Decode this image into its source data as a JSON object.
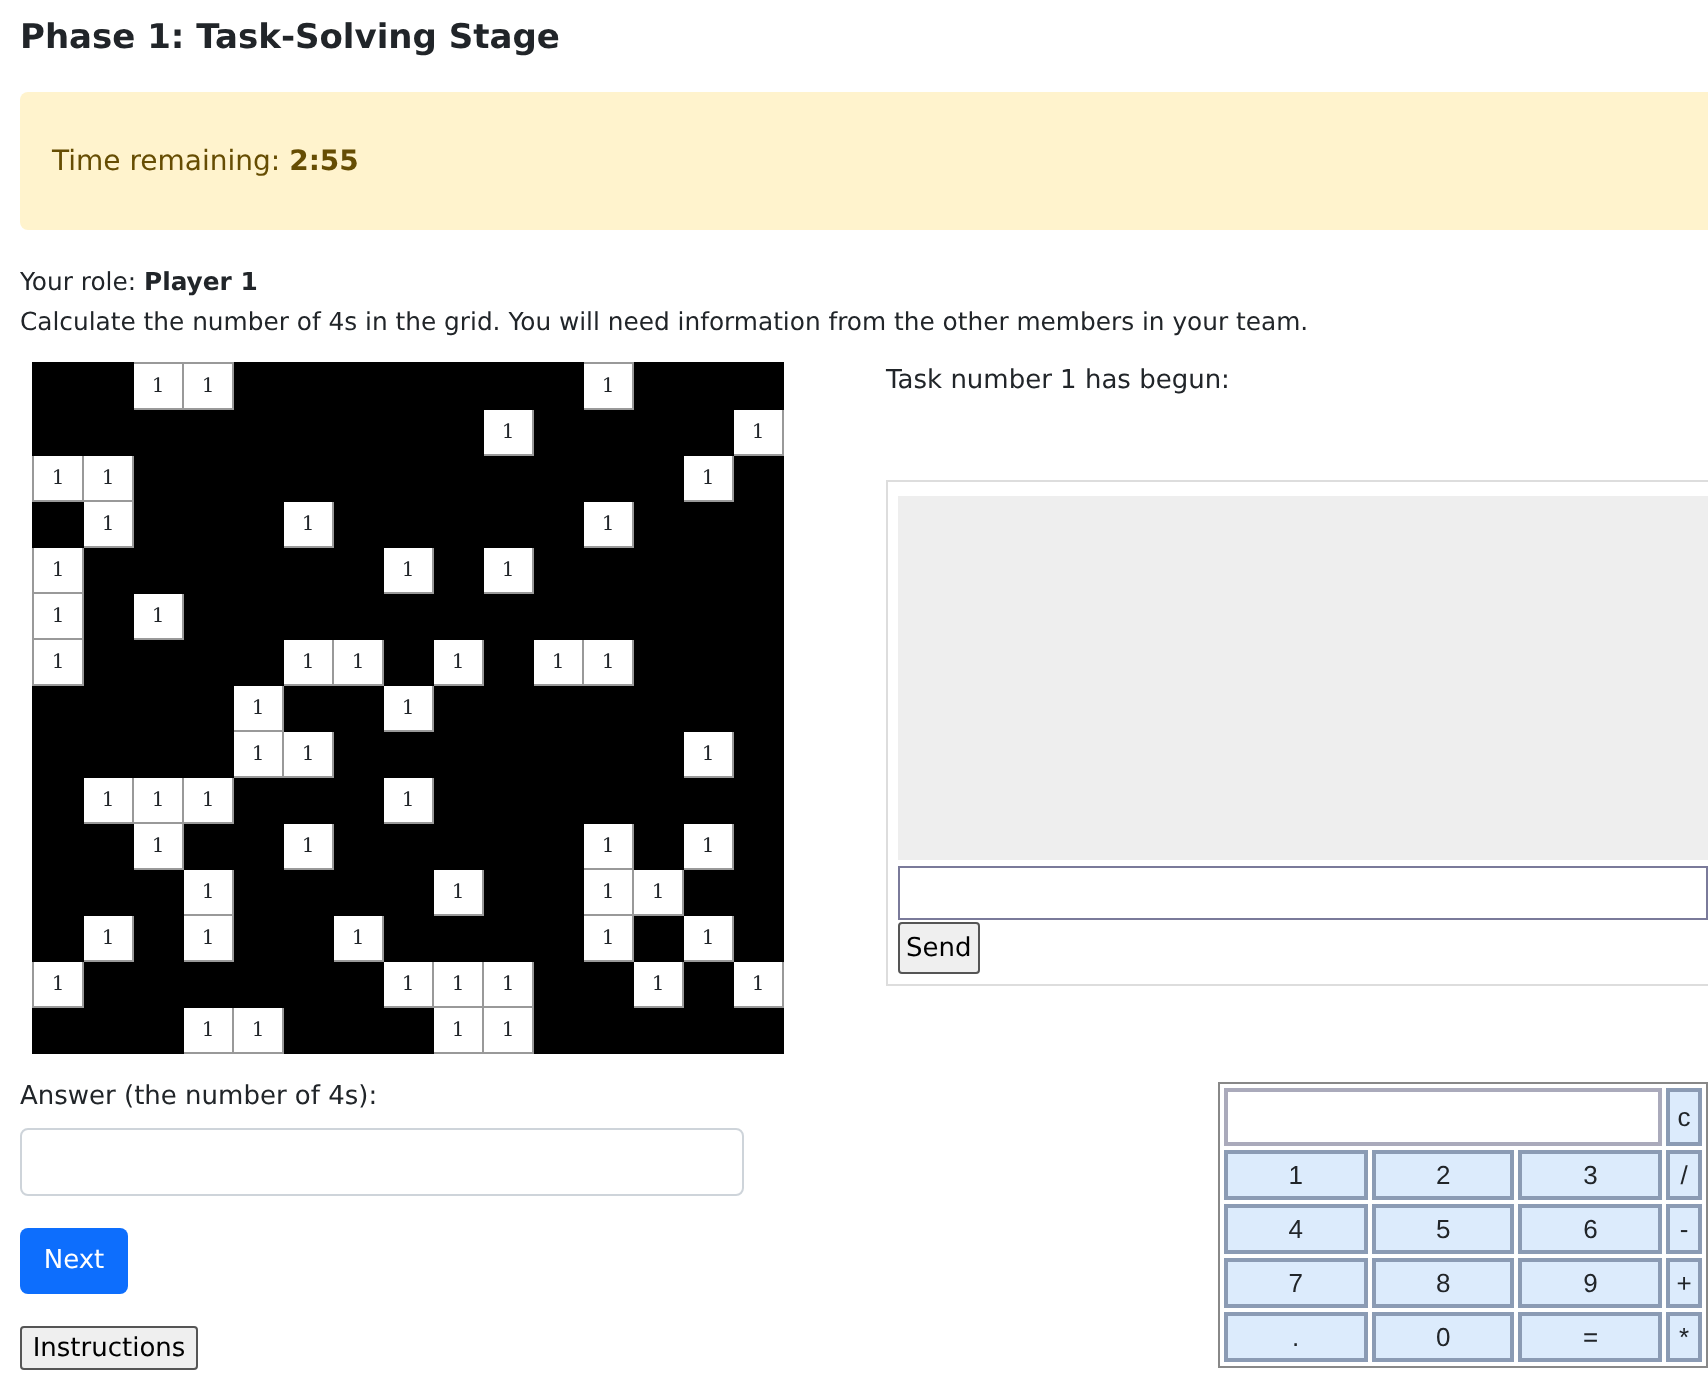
{
  "title": "Phase 1: Task-Solving Stage",
  "timer": {
    "label": "Time remaining:",
    "value": "2:55"
  },
  "role": {
    "label": "Your role:",
    "value": "Player 1"
  },
  "instructions_text": "Calculate the number of 4s in the grid. You will need information from the other members in your team.",
  "grid": [
    [
      {
        "filled": false
      },
      {
        "filled": false
      },
      {
        "filled": true,
        "value": "1"
      },
      {
        "filled": true,
        "value": "1"
      },
      {
        "filled": false
      },
      {
        "filled": false
      },
      {
        "filled": false
      },
      {
        "filled": false
      },
      {
        "filled": false
      },
      {
        "filled": false
      },
      {
        "filled": false
      },
      {
        "filled": true,
        "value": "1"
      },
      {
        "filled": false
      },
      {
        "filled": false
      },
      {
        "filled": false
      }
    ],
    [
      {
        "filled": false
      },
      {
        "filled": false
      },
      {
        "filled": false
      },
      {
        "filled": false
      },
      {
        "filled": false
      },
      {
        "filled": false
      },
      {
        "filled": false
      },
      {
        "filled": false
      },
      {
        "filled": false
      },
      {
        "filled": true,
        "value": "1"
      },
      {
        "filled": false
      },
      {
        "filled": false
      },
      {
        "filled": false
      },
      {
        "filled": false
      },
      {
        "filled": true,
        "value": "1"
      }
    ],
    [
      {
        "filled": true,
        "value": "1"
      },
      {
        "filled": true,
        "value": "1"
      },
      {
        "filled": false
      },
      {
        "filled": false
      },
      {
        "filled": false
      },
      {
        "filled": false
      },
      {
        "filled": false
      },
      {
        "filled": false
      },
      {
        "filled": false
      },
      {
        "filled": false
      },
      {
        "filled": false
      },
      {
        "filled": false
      },
      {
        "filled": false
      },
      {
        "filled": true,
        "value": "1"
      },
      {
        "filled": false
      }
    ],
    [
      {
        "filled": false
      },
      {
        "filled": true,
        "value": "1"
      },
      {
        "filled": false
      },
      {
        "filled": false
      },
      {
        "filled": false
      },
      {
        "filled": true,
        "value": "1"
      },
      {
        "filled": false
      },
      {
        "filled": false
      },
      {
        "filled": false
      },
      {
        "filled": false
      },
      {
        "filled": false
      },
      {
        "filled": true,
        "value": "1"
      },
      {
        "filled": false
      },
      {
        "filled": false
      },
      {
        "filled": false
      }
    ],
    [
      {
        "filled": true,
        "value": "1"
      },
      {
        "filled": false
      },
      {
        "filled": false
      },
      {
        "filled": false
      },
      {
        "filled": false
      },
      {
        "filled": false
      },
      {
        "filled": false
      },
      {
        "filled": true,
        "value": "1"
      },
      {
        "filled": false
      },
      {
        "filled": true,
        "value": "1"
      },
      {
        "filled": false
      },
      {
        "filled": false
      },
      {
        "filled": false
      },
      {
        "filled": false
      },
      {
        "filled": false
      }
    ],
    [
      {
        "filled": true,
        "value": "1"
      },
      {
        "filled": false
      },
      {
        "filled": true,
        "value": "1"
      },
      {
        "filled": false
      },
      {
        "filled": false
      },
      {
        "filled": false
      },
      {
        "filled": false
      },
      {
        "filled": false
      },
      {
        "filled": false
      },
      {
        "filled": false
      },
      {
        "filled": false
      },
      {
        "filled": false
      },
      {
        "filled": false
      },
      {
        "filled": false
      },
      {
        "filled": false
      }
    ],
    [
      {
        "filled": true,
        "value": "1"
      },
      {
        "filled": false
      },
      {
        "filled": false
      },
      {
        "filled": false
      },
      {
        "filled": false
      },
      {
        "filled": true,
        "value": "1"
      },
      {
        "filled": true,
        "value": "1"
      },
      {
        "filled": false
      },
      {
        "filled": true,
        "value": "1"
      },
      {
        "filled": false
      },
      {
        "filled": true,
        "value": "1"
      },
      {
        "filled": true,
        "value": "1"
      },
      {
        "filled": false
      },
      {
        "filled": false
      },
      {
        "filled": false
      }
    ],
    [
      {
        "filled": false
      },
      {
        "filled": false
      },
      {
        "filled": false
      },
      {
        "filled": false
      },
      {
        "filled": true,
        "value": "1"
      },
      {
        "filled": false
      },
      {
        "filled": false
      },
      {
        "filled": true,
        "value": "1"
      },
      {
        "filled": false
      },
      {
        "filled": false
      },
      {
        "filled": false
      },
      {
        "filled": false
      },
      {
        "filled": false
      },
      {
        "filled": false
      },
      {
        "filled": false
      }
    ],
    [
      {
        "filled": false
      },
      {
        "filled": false
      },
      {
        "filled": false
      },
      {
        "filled": false
      },
      {
        "filled": true,
        "value": "1"
      },
      {
        "filled": true,
        "value": "1"
      },
      {
        "filled": false
      },
      {
        "filled": false
      },
      {
        "filled": false
      },
      {
        "filled": false
      },
      {
        "filled": false
      },
      {
        "filled": false
      },
      {
        "filled": false
      },
      {
        "filled": true,
        "value": "1"
      },
      {
        "filled": false
      }
    ],
    [
      {
        "filled": false
      },
      {
        "filled": true,
        "value": "1"
      },
      {
        "filled": true,
        "value": "1"
      },
      {
        "filled": true,
        "value": "1"
      },
      {
        "filled": false
      },
      {
        "filled": false
      },
      {
        "filled": false
      },
      {
        "filled": true,
        "value": "1"
      },
      {
        "filled": false
      },
      {
        "filled": false
      },
      {
        "filled": false
      },
      {
        "filled": false
      },
      {
        "filled": false
      },
      {
        "filled": false
      },
      {
        "filled": false
      }
    ],
    [
      {
        "filled": false
      },
      {
        "filled": false
      },
      {
        "filled": true,
        "value": "1"
      },
      {
        "filled": false
      },
      {
        "filled": false
      },
      {
        "filled": true,
        "value": "1"
      },
      {
        "filled": false
      },
      {
        "filled": false
      },
      {
        "filled": false
      },
      {
        "filled": false
      },
      {
        "filled": false
      },
      {
        "filled": true,
        "value": "1"
      },
      {
        "filled": false
      },
      {
        "filled": true,
        "value": "1"
      },
      {
        "filled": false
      }
    ],
    [
      {
        "filled": false
      },
      {
        "filled": false
      },
      {
        "filled": false
      },
      {
        "filled": true,
        "value": "1"
      },
      {
        "filled": false
      },
      {
        "filled": false
      },
      {
        "filled": false
      },
      {
        "filled": false
      },
      {
        "filled": true,
        "value": "1"
      },
      {
        "filled": false
      },
      {
        "filled": false
      },
      {
        "filled": true,
        "value": "1"
      },
      {
        "filled": true,
        "value": "1"
      },
      {
        "filled": false
      },
      {
        "filled": false
      }
    ],
    [
      {
        "filled": false
      },
      {
        "filled": true,
        "value": "1"
      },
      {
        "filled": false
      },
      {
        "filled": true,
        "value": "1"
      },
      {
        "filled": false
      },
      {
        "filled": false
      },
      {
        "filled": true,
        "value": "1"
      },
      {
        "filled": false
      },
      {
        "filled": false
      },
      {
        "filled": false
      },
      {
        "filled": false
      },
      {
        "filled": true,
        "value": "1"
      },
      {
        "filled": false
      },
      {
        "filled": true,
        "value": "1"
      },
      {
        "filled": false
      }
    ],
    [
      {
        "filled": true,
        "value": "1"
      },
      {
        "filled": false
      },
      {
        "filled": false
      },
      {
        "filled": false
      },
      {
        "filled": false
      },
      {
        "filled": false
      },
      {
        "filled": false
      },
      {
        "filled": true,
        "value": "1"
      },
      {
        "filled": true,
        "value": "1"
      },
      {
        "filled": true,
        "value": "1"
      },
      {
        "filled": false
      },
      {
        "filled": false
      },
      {
        "filled": true,
        "value": "1"
      },
      {
        "filled": false
      },
      {
        "filled": true,
        "value": "1"
      }
    ],
    [
      {
        "filled": false
      },
      {
        "filled": false
      },
      {
        "filled": false
      },
      {
        "filled": true,
        "value": "1"
      },
      {
        "filled": true,
        "value": "1"
      },
      {
        "filled": false
      },
      {
        "filled": false
      },
      {
        "filled": false
      },
      {
        "filled": true,
        "value": "1"
      },
      {
        "filled": true,
        "value": "1"
      },
      {
        "filled": false
      },
      {
        "filled": false
      },
      {
        "filled": false
      },
      {
        "filled": false
      },
      {
        "filled": false
      }
    ]
  ],
  "answer": {
    "label": "Answer (the number of 4s):"
  },
  "buttons": {
    "next": "Next",
    "instructions": "Instructions"
  },
  "chat": {
    "status": "Task number 1 has begun:",
    "send": "Send"
  },
  "calculator": {
    "clear": "c",
    "rows": [
      [
        "1",
        "2",
        "3",
        "/"
      ],
      [
        "4",
        "5",
        "6",
        "-"
      ],
      [
        "7",
        "8",
        "9",
        "+"
      ],
      [
        ".",
        "0",
        "=",
        "*"
      ]
    ]
  }
}
